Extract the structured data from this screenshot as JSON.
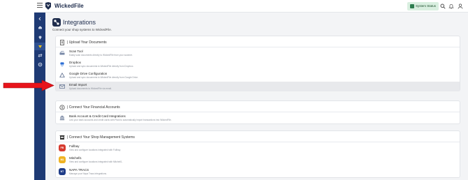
{
  "app": {
    "brand": "WickedFile"
  },
  "header": {
    "system_status_label": "System Status"
  },
  "page": {
    "title": "Integrations",
    "subtitle": "Connect your shop systems to WickedFile."
  },
  "sections": [
    {
      "title": "| Upload Your Documents",
      "items": [
        {
          "title": "Scan Tool",
          "description": "Easily scan documents directly to WickedFile from your scanner.",
          "icon": "scanner-icon"
        },
        {
          "title": "Dropbox",
          "description": "Upload and sync documents to WickedFile directly from Dropbox.",
          "icon": "dropbox-icon"
        },
        {
          "title": "Google Drive Configuration",
          "description": "Upload and sync documents to WickedFile directly from Google Drive.",
          "icon": "google-drive-icon"
        },
        {
          "title": "Email Import",
          "description": "Upload documents to WickedFile via email.",
          "icon": "email-icon"
        }
      ]
    },
    {
      "title": "| Connect Your Financial Accounts",
      "items": [
        {
          "title": "Bank Account & Credit Card Integrations",
          "description": "Link your bank accounts and credit cards with Plaid to automatically import transactions into WickedFile.",
          "icon": "bank-icon"
        }
      ]
    },
    {
      "title": "| Connect Your Shop Management Systems",
      "items": [
        {
          "title": "Fullbay",
          "description": "View and configure locations integrated with Fullbay.",
          "badge": "FB",
          "badge_color": "#d63a2f"
        },
        {
          "title": "Mitchell1",
          "description": "View and configure locations integrated with Mitchell1.",
          "badge": "M1",
          "badge_color": "#f0b323"
        },
        {
          "title": "NAPA TRACS",
          "description": "Manage your Napa Tracs integrations.",
          "badge": "NT",
          "badge_color": "#1f3c88"
        }
      ]
    }
  ],
  "colors": {
    "sidebar": "#1e3a74",
    "arrow": "#e8141b",
    "status_bg": "#d9efe0"
  }
}
